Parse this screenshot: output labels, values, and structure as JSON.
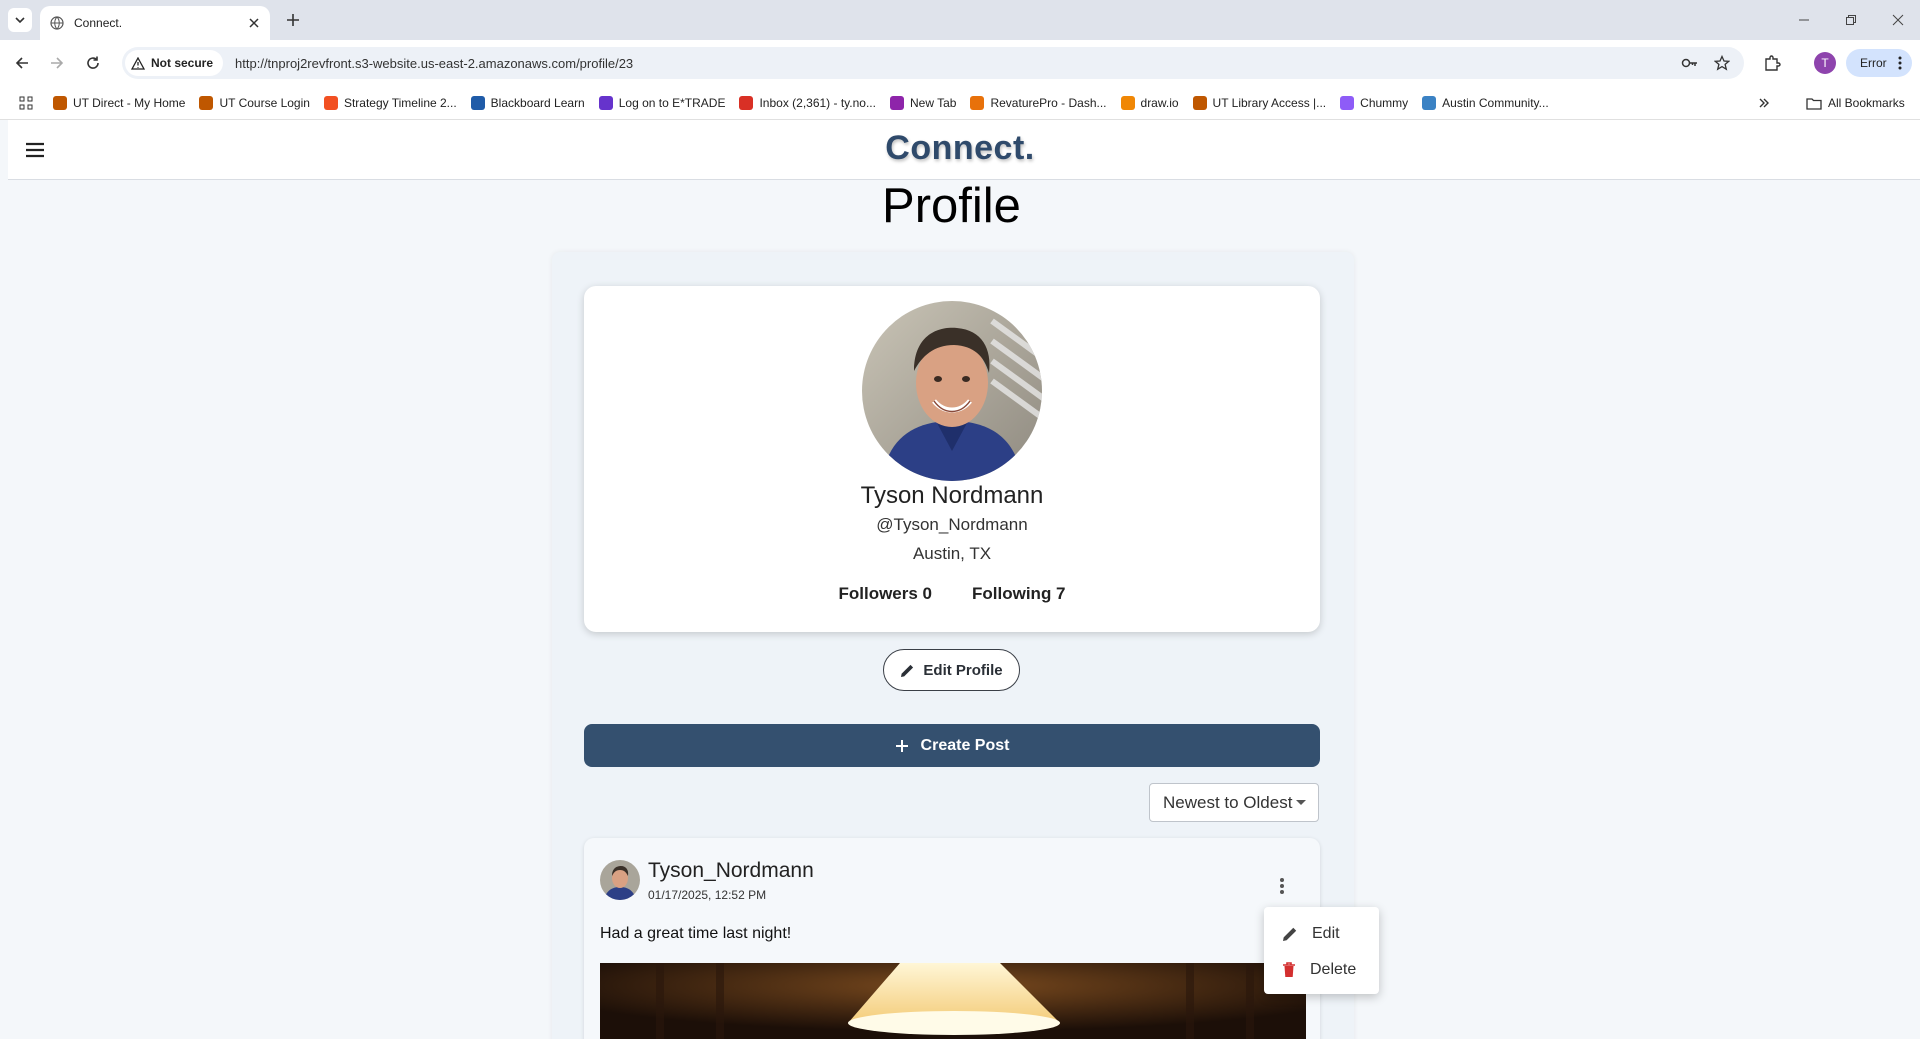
{
  "browser": {
    "tab_title": "Connect.",
    "security_label": "Not secure",
    "url": "http://tnproj2revfront.s3-website.us-east-2.amazonaws.com/profile/23",
    "profile_initial": "T",
    "error_label": "Error"
  },
  "bookmarks": {
    "items": [
      {
        "label": "UT Direct - My Home",
        "color": "#bf5700"
      },
      {
        "label": "UT Course Login",
        "color": "#bf5700"
      },
      {
        "label": "Strategy Timeline 2...",
        "color": "#f25022"
      },
      {
        "label": "Blackboard Learn",
        "color": "#1f5ba8"
      },
      {
        "label": "Log on to E*TRADE",
        "color": "#6633cc"
      },
      {
        "label": "Inbox (2,361) - ty.no...",
        "color": "#d93025"
      },
      {
        "label": "New Tab",
        "color": "#8e24aa"
      },
      {
        "label": "RevaturePro - Dash...",
        "color": "#e8710a"
      },
      {
        "label": "draw.io",
        "color": "#f08705"
      },
      {
        "label": "UT Library Access |...",
        "color": "#bf5700"
      },
      {
        "label": "Chummy",
        "color": "#8e5cf7"
      },
      {
        "label": "Austin Community...",
        "color": "#3b82c4"
      }
    ],
    "all_bookmarks_label": "All Bookmarks"
  },
  "app": {
    "brand": "Connect.",
    "page_title": "Profile",
    "accent_color": "#34506f"
  },
  "profile": {
    "name": "Tyson Nordmann",
    "handle": "@Tyson_Nordmann",
    "location": "Austin, TX",
    "followers_label": "Followers 0",
    "following_label": "Following 7",
    "edit_button_label": "Edit Profile"
  },
  "create_post_label": "Create Post",
  "sort": {
    "selected": "Newest to Oldest"
  },
  "post": {
    "author": "Tyson_Nordmann",
    "date": "01/17/2025, 12:52 PM",
    "text": "Had a great time last night!"
  },
  "post_menu": {
    "edit_label": "Edit",
    "delete_label": "Delete",
    "delete_icon_color": "#d32f2f"
  }
}
